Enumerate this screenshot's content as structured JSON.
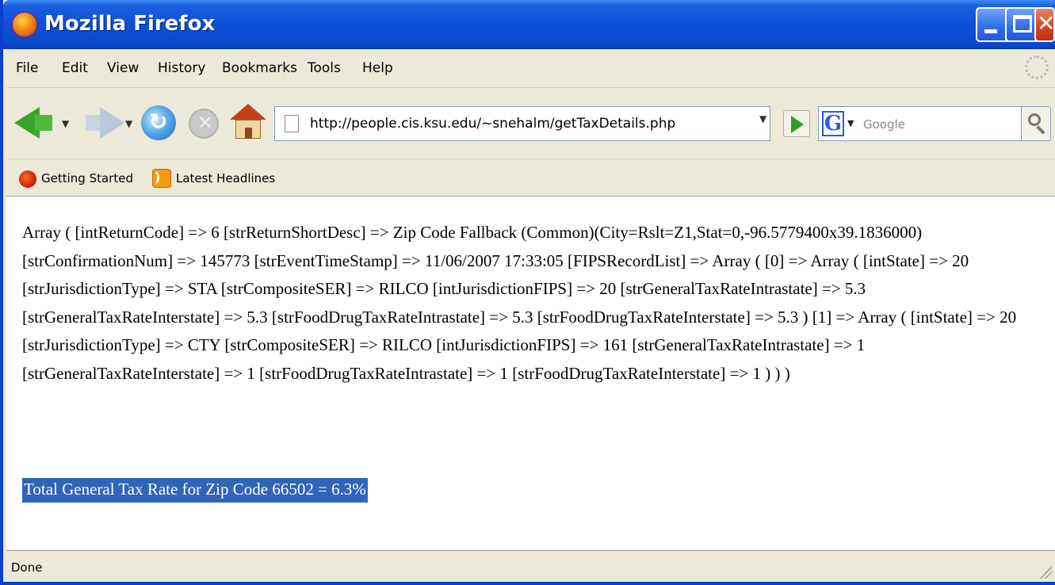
{
  "window": {
    "title": "Mozilla Firefox"
  },
  "menu": {
    "items": [
      "File",
      "Edit",
      "View",
      "History",
      "Bookmarks",
      "Tools",
      "Help"
    ]
  },
  "navigation": {
    "url": "http://people.cis.ksu.edu/~snehalm/getTaxDetails.php",
    "search_placeholder": "Google",
    "search_engine_letter": "G"
  },
  "bookmarks": {
    "items": [
      {
        "label": "Getting Started",
        "icon": "firefox-bookmark-icon"
      },
      {
        "label": "Latest Headlines",
        "icon": "rss-feed-icon"
      }
    ]
  },
  "content": {
    "array_dump": "Array ( [intReturnCode] => 6 [strReturnShortDesc] => Zip Code Fallback (Common)(City=Rslt=Z1,Stat=0,-96.5779400x39.1836000) [strConfirmationNum] => 145773 [strEventTimeStamp] => 11/06/2007 17:33:05 [FIPSRecordList] => Array ( [0] => Array ( [intState] => 20 [strJurisdictionType] => STA [strCompositeSER] => RILCO [intJurisdictionFIPS] => 20 [strGeneralTaxRateIntrastate] => 5.3 [strGeneralTaxRateInterstate] => 5.3 [strFoodDrugTaxRateIntrastate] => 5.3 [strFoodDrugTaxRateInterstate] => 5.3 ) [1] => Array ( [intState] => 20 [strJurisdictionType] => CTY [strCompositeSER] => RILCO [intJurisdictionFIPS] => 161 [strGeneralTaxRateIntrastate] => 1 [strGeneralTaxRateInterstate] => 1 [strFoodDrugTaxRateIntrastate] => 1 [strFoodDrugTaxRateInterstate] => 1 ) ) )",
    "result_line": "Total General Tax Rate for Zip Code 66502 = 6.3%"
  },
  "status": {
    "text": "Done"
  },
  "colors": {
    "titlebar": "#0c4fd6",
    "selection_highlight": "#3064b8",
    "chrome_background": "#ece9d8"
  }
}
